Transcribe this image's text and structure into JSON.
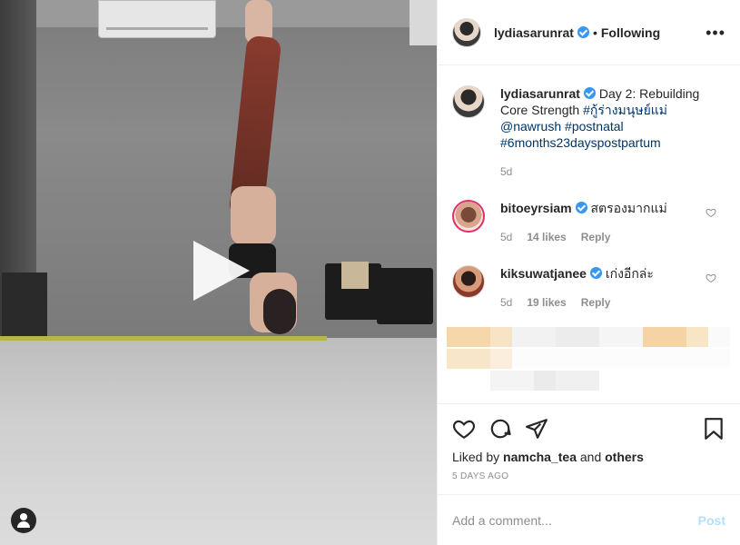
{
  "post": {
    "author": {
      "username": "lydiasarunrat",
      "verified": true,
      "follow_status": "Following"
    },
    "header_separator": "•",
    "more_options_icon": "more-horizontal-icon",
    "media": {
      "type": "video",
      "play_icon": "play-icon",
      "tag_icon": "user-tag-icon"
    },
    "caption": {
      "username": "lydiasarunrat",
      "text": "Day 2: Rebuilding Core Strength",
      "tags": [
        "#กู้ร่างมนุษย์แม่",
        "@nawrush",
        "#postnatal",
        "#6months23dayspostpartum"
      ],
      "age": "5d"
    },
    "comments": [
      {
        "username": "bitoeyrsiam",
        "verified": true,
        "text": "สตรองมากแม่",
        "age": "5d",
        "likes": "14 likes",
        "reply_label": "Reply",
        "has_story": true
      },
      {
        "username": "kiksuwatjanee",
        "verified": true,
        "text": "เก่งอีกล่ะ",
        "age": "5d",
        "likes": "19 likes",
        "reply_label": "Reply",
        "has_story": false
      }
    ],
    "actions": {
      "like_icon": "heart-icon",
      "comment_icon": "comment-icon",
      "share_icon": "send-icon",
      "save_icon": "bookmark-icon"
    },
    "liked_by": {
      "prefix": "Liked by",
      "user": "namcha_tea",
      "conjunction": "and",
      "suffix": "others"
    },
    "time_ago": "5 DAYS AGO",
    "add_comment": {
      "placeholder": "Add a comment...",
      "post_label": "Post"
    }
  }
}
